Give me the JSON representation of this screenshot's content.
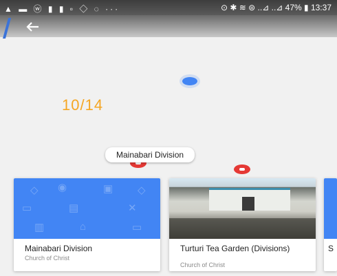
{
  "status_bar": {
    "left_icons": "▲ ▬ ⓦ ▮ ▮ ▫ ◇ ◌  ···",
    "right_text": "⊙ ✱ ≋ ⊜ ..⊿ ..⊿ 47% ▮ 13:37"
  },
  "app_bar": {
    "back_icon": "arrow-left-icon"
  },
  "map": {
    "counter": "10/14",
    "callout_label": "Mainabari Division"
  },
  "cards": [
    {
      "title": "Mainabari Division",
      "subtitle": "Church of Christ",
      "image": "blue-placeholder"
    },
    {
      "title": "Turturi Tea Garden (Divisions)",
      "subtitle": "Church of Christ",
      "image": "photo"
    },
    {
      "title": "S",
      "subtitle": "",
      "image": "blue-placeholder"
    }
  ],
  "colors": {
    "accent_blue": "#4285f4",
    "counter_orange": "#f5a623",
    "marker_red": "#e53935"
  }
}
